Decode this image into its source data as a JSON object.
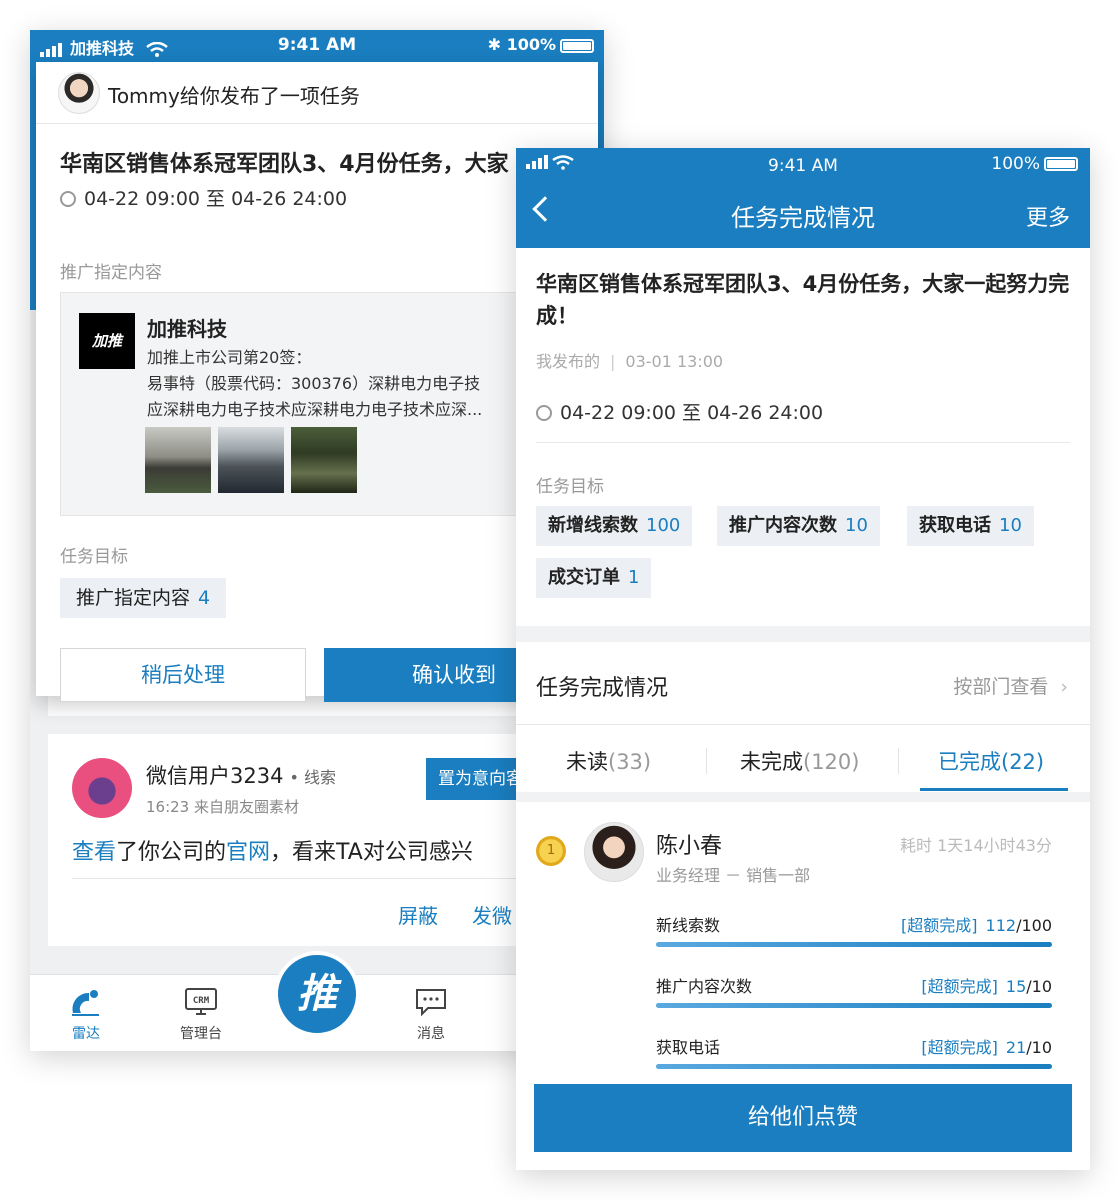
{
  "colors": {
    "accent": "#1a7ec0",
    "background": "#ffffff",
    "muted_text": "#999999"
  },
  "left_phone": {
    "status": {
      "carrier": "加推科技",
      "time": "9:41 AM",
      "battery": "100%"
    },
    "popup": {
      "notice": "Tommy给你发布了一项任务",
      "title": "华南区销售体系冠军团队3、4月份任务，大家",
      "time_range": "04-22 09:00 至 04-26 24:00",
      "content_label": "推广指定内容",
      "promo": {
        "logo_text": "加推",
        "company": "加推科技",
        "lines": [
          "加推上市公司第20签：",
          "易事特（股票代码：300376）深耕电力电子技",
          "应深耕电力电子技术应深耕电力电子技术应深..."
        ]
      },
      "goal_label": "任务目标",
      "goal": {
        "label": "推广指定内容",
        "value": "4"
      },
      "later_button": "稍后处理",
      "confirm_button": "确认收到"
    },
    "lead": {
      "name": "微信用户3234",
      "tag": "• 线索",
      "meta": "16:23  来自朋友圈素材",
      "intent_button": "置为意向客",
      "msg_prefix": "查看",
      "msg_mid1": "了你公司的",
      "msg_link": "官网",
      "msg_suffix": "，看来TA对公司感兴",
      "action_block": "屏蔽",
      "action_send": "发微"
    },
    "tabbar": {
      "radar": "雷达",
      "admin": "管理台",
      "admin_icon_text": "CRM",
      "push": "推",
      "message": "消息"
    }
  },
  "right_phone": {
    "status": {
      "time": "9:41 AM",
      "battery": "100%"
    },
    "nav": {
      "title": "任务完成情况",
      "more": "更多"
    },
    "task_title": "华南区销售体系冠军团队3、4月份任务，大家一起努力完成！",
    "published_by": "我发布的",
    "published_at": "03-01 13:00",
    "time_range": "04-22 09:00 至 04-26 24:00",
    "goal_label": "任务目标",
    "goals": [
      {
        "label": "新增线索数",
        "value": "100"
      },
      {
        "label": "推广内容次数",
        "value": "10"
      },
      {
        "label": "获取电话",
        "value": "10"
      },
      {
        "label": "成交订单",
        "value": "1"
      }
    ],
    "section_title": "任务完成情况",
    "section_link": "按部门查看",
    "tabs": [
      {
        "label": "未读",
        "count": "(33)"
      },
      {
        "label": "未完成",
        "count": "(120)"
      },
      {
        "label": "已完成",
        "count": "(22)"
      }
    ],
    "person": {
      "rank": "1",
      "name": "陈小春",
      "role": "业务经理 － 销售一部",
      "duration": "耗时 1天14小时43分",
      "metrics": [
        {
          "label": "新线索数",
          "tag": "[超额完成]",
          "current": "112",
          "target": "/100",
          "progress": 1.0
        },
        {
          "label": "推广内容次数",
          "tag": "[超额完成]",
          "current": "15",
          "target": "/10",
          "progress": 1.0
        },
        {
          "label": "获取电话",
          "tag": "[超额完成]",
          "current": "21",
          "target": "/10",
          "progress": 1.0
        }
      ]
    },
    "like_button": "给他们点赞"
  }
}
